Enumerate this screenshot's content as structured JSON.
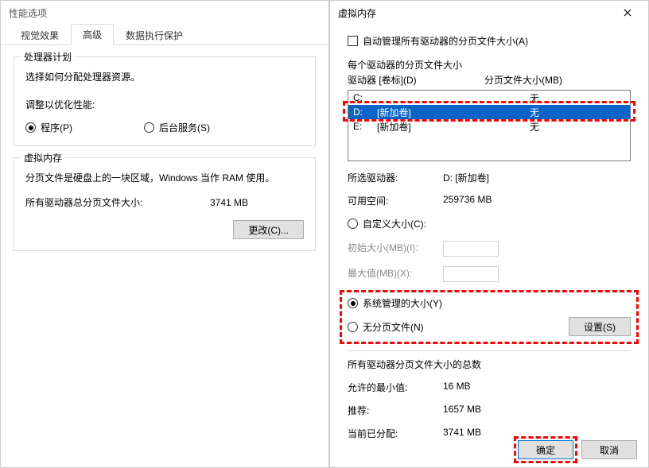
{
  "left": {
    "title": "性能选项",
    "tabs": {
      "visual": "视觉效果",
      "advanced": "高级",
      "dep": "数据执行保护"
    },
    "sched": {
      "title": "处理器计划",
      "hint": "选择如何分配处理器资源。",
      "adjust": "调整以优化性能:",
      "program": "程序(P)",
      "background": "后台服务(S)"
    },
    "vm": {
      "title": "虚拟内存",
      "desc": "分页文件是硬盘上的一块区域，Windows 当作 RAM 使用。",
      "total_label": "所有驱动器总分页文件大小:",
      "total_value": "3741 MB",
      "change_btn": "更改(C)..."
    }
  },
  "right": {
    "title": "虚拟内存",
    "auto_manage": "自动管理所有驱动器的分页文件大小(A)",
    "per_drive_title": "每个驱动器的分页文件大小",
    "drive_header_a": "驱动器 [卷标](D)",
    "drive_header_b": "分页文件大小(MB)",
    "drives": [
      {
        "letter": "C:",
        "label": "",
        "size": "无"
      },
      {
        "letter": "D:",
        "label": "[新加卷]",
        "size": "无"
      },
      {
        "letter": "E:",
        "label": "[新加卷]",
        "size": "无"
      }
    ],
    "selected_drive_label": "所选驱动器:",
    "selected_drive_value": "D:  [新加卷]",
    "free_space_label": "可用空间:",
    "free_space_value": "259736 MB",
    "custom_size": "自定义大小(C):",
    "initial_size": "初始大小(MB)(I):",
    "max_size": "最大值(MB)(X):",
    "system_managed": "系统管理的大小(Y)",
    "no_page_file": "无分页文件(N)",
    "set_btn": "设置(S)",
    "totals_title": "所有驱动器分页文件大小的总数",
    "min_label": "允许的最小值:",
    "min_value": "16 MB",
    "rec_label": "推荐:",
    "rec_value": "1657 MB",
    "cur_label": "当前已分配:",
    "cur_value": "3741 MB",
    "ok_btn": "确定",
    "cancel_btn": "取消"
  }
}
